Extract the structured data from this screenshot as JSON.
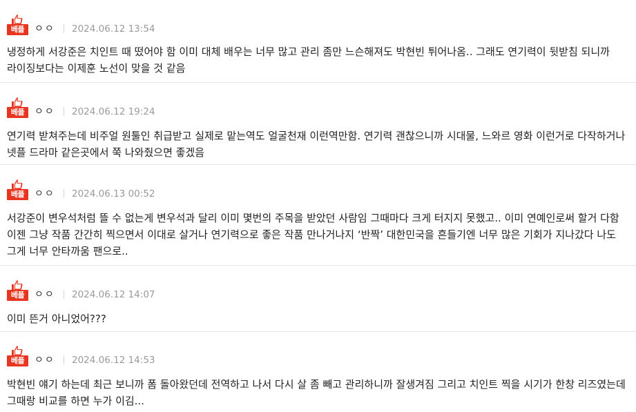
{
  "badge_label": "베플",
  "accent_color": "#e8351f",
  "comments": [
    {
      "author": "ㅇㅇ",
      "date": "2024.06.12 13:54",
      "text": "냉정하게 서강준은 치인트 때 떴어야 함 이미 대체 배우는 너무 많고 관리 좀만 느슨해져도 박현빈 튀어나옴.. 그래도 연기력이 뒷받침 되니까 라이징보다는 이제훈 노선이 맞을 것 같음"
    },
    {
      "author": "ㅇㅇ",
      "date": "2024.06.12 19:24",
      "text": "연기력 받쳐주는데 비주얼 원툴인 취급받고 실제로 맡는역도 얼굴천재 이런역만함. 연기력 괜찮으니까 시대물, 느와르 영화 이런거로 다작하거나 넷플 드라마 같은곳에서 쭉 나와줬으면 좋겠음"
    },
    {
      "author": "ㅇㅇ",
      "date": "2024.06.13 00:52",
      "text": "서강준이 변우석처럼 뜰 수 없는게 변우석과 달리 이미 몇번의 주목을 받았던 사람임 그때마다 크게 터지지 못했고.. 이미 연예인로써 할거 다함 이젠 그냥 작품 간간히 찍으면서 이대로 살거나 연기력으로 좋은 작품 만나거나지 ‘반짝’ 대한민국을 흔들기엔 너무 많은 기회가 지나갔다 나도 그게 너무 안타까움 팬으로.."
    },
    {
      "author": "ㅇㅇ",
      "date": "2024.06.12 14:07",
      "text": "이미 뜬거 아니었어???"
    },
    {
      "author": "ㅇㅇ",
      "date": "2024.06.12 14:53",
      "text": "박현빈 얘기 하는데 최근 보니까 폼 돌아왔던데 전역하고 나서 다시 살 좀 빼고 관리하니까 잘생겨짐 그리고 치인트 찍을 시기가 한창 리즈였는데 그때랑 비교를 하면 누가 이김..."
    }
  ]
}
